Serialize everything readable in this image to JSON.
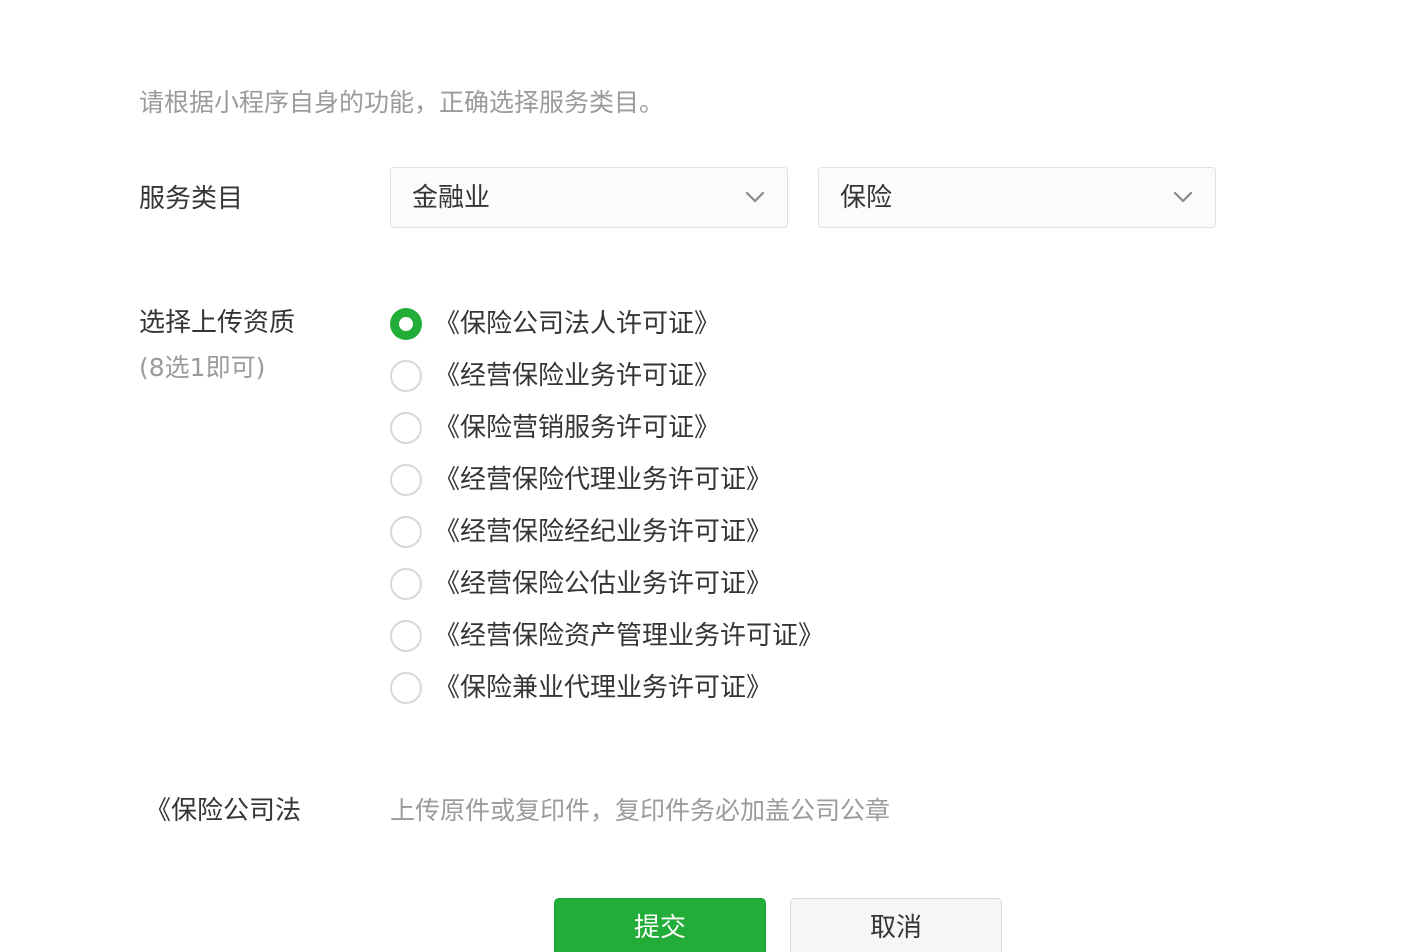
{
  "hint": "请根据小程序自身的功能，正确选择服务类目。",
  "service_category": {
    "label": "服务类目",
    "primary_select": "金融业",
    "secondary_select": "保险"
  },
  "qualification": {
    "label": "选择上传资质",
    "sub_label": "(8选1即可)",
    "options": [
      {
        "label": "《保险公司法人许可证》",
        "selected": true
      },
      {
        "label": "《经营保险业务许可证》",
        "selected": false
      },
      {
        "label": "《保险营销服务许可证》",
        "selected": false
      },
      {
        "label": "《经营保险代理业务许可证》",
        "selected": false
      },
      {
        "label": "《经营保险经纪业务许可证》",
        "selected": false
      },
      {
        "label": "《经营保险公估业务许可证》",
        "selected": false
      },
      {
        "label": "《经营保险资产管理业务许可证》",
        "selected": false
      },
      {
        "label": "《保险兼业代理业务许可证》",
        "selected": false
      }
    ]
  },
  "upload": {
    "label": "《保险公司法",
    "hint": "上传原件或复印件，复印件务必加盖公司公章"
  },
  "actions": {
    "submit": "提交",
    "cancel": "取消"
  },
  "colors": {
    "accent": "#22ac38",
    "text": "#353535",
    "muted": "#9b9b9b"
  }
}
